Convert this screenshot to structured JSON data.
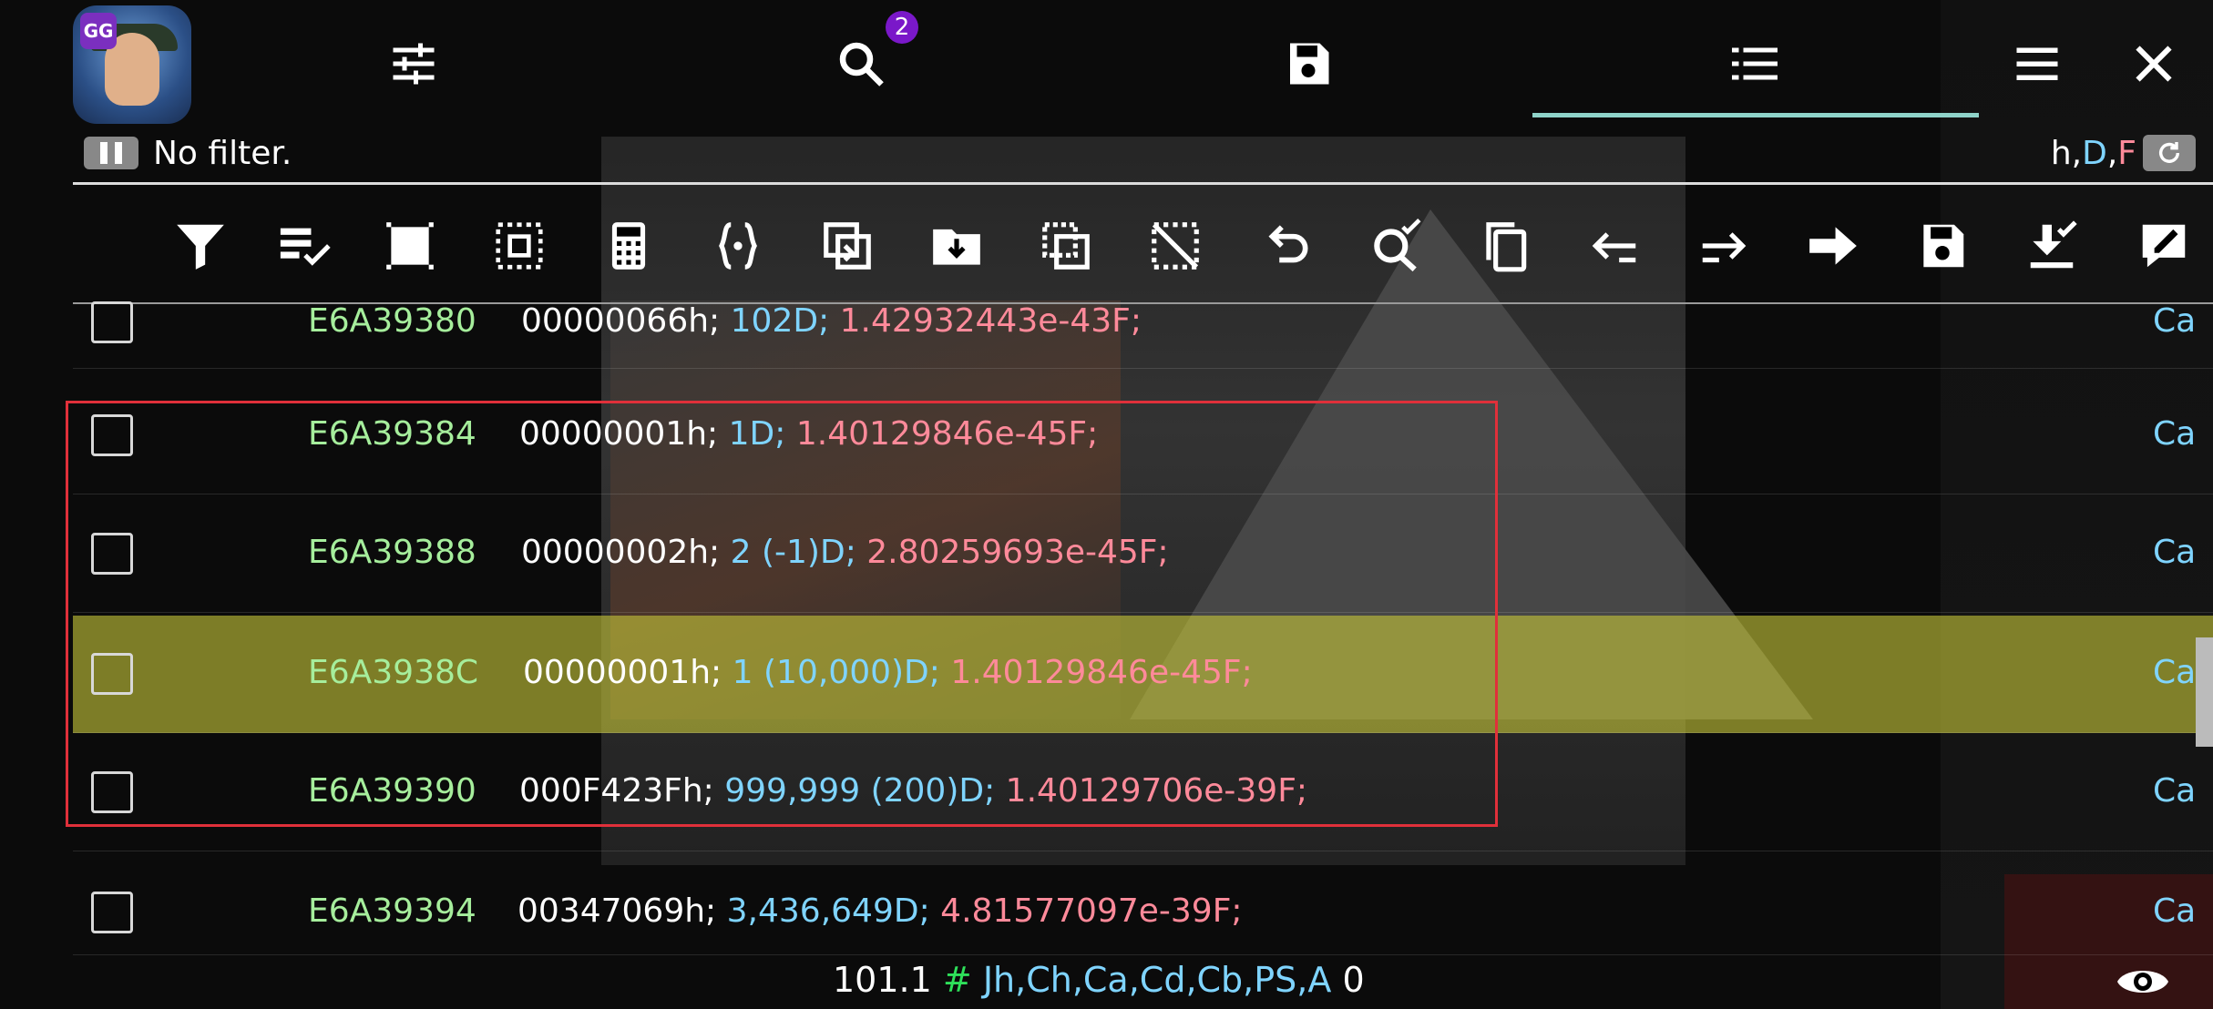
{
  "app": {
    "icon_badge": "GG"
  },
  "toolbar_top": {
    "search_badge": "2"
  },
  "filter": {
    "label": "No filter.",
    "types_h": "h",
    "types_D": "D",
    "types_F": "F",
    "sep1": ",",
    "sep2": ","
  },
  "rows": [
    {
      "address": "E6A39380",
      "hex": "00000066h;",
      "dec": "102D;",
      "float": "1.42932443e-43F;",
      "region": "Ca",
      "selected": false,
      "highlighted": false
    },
    {
      "address": "E6A39384",
      "hex": "00000001h;",
      "dec": "1D;",
      "float": "1.40129846e-45F;",
      "region": "Ca",
      "selected": false,
      "highlighted": false
    },
    {
      "address": "E6A39388",
      "hex": "00000002h;",
      "dec": "2 (-1)D;",
      "float": "2.80259693e-45F;",
      "region": "Ca",
      "selected": false,
      "highlighted": false
    },
    {
      "address": "E6A3938C",
      "hex": "00000001h;",
      "dec": "1 (10,000)D;",
      "float": "1.40129846e-45F;",
      "region": "Ca",
      "selected": false,
      "highlighted": true
    },
    {
      "address": "E6A39390",
      "hex": "000F423Fh;",
      "dec": "999,999 (200)D;",
      "float": "1.40129706e-39F;",
      "region": "Ca",
      "selected": false,
      "highlighted": false
    },
    {
      "address": "E6A39394",
      "hex": "00347069h;",
      "dec": "3,436,649D;",
      "float": "4.81577097e-39F;",
      "region": "Ca",
      "selected": false,
      "highlighted": false
    }
  ],
  "status": {
    "count": "101.1",
    "hash": "#",
    "regions": "Jh,Ch,Ca,Cd,Cb,PS,A",
    "zero": "0"
  },
  "colors": {
    "address": "#a6ee9c",
    "decimal": "#7fd4ff",
    "float": "#ff8a9a",
    "highlight": "#c4c438",
    "selection_box": "#e0303a",
    "tab_underline": "#8fd3c9",
    "badge": "#7a18c9"
  },
  "icons": {
    "top": [
      "settings-sliders-icon",
      "search-icon",
      "save-icon",
      "list-icon",
      "menu-icon",
      "close-icon"
    ],
    "toolbar": [
      "filter-icon",
      "select-edit-icon",
      "select-all-icon",
      "invert-selection-icon",
      "calculator-icon",
      "braces-icon",
      "copy-to-icon",
      "move-to-folder-icon",
      "clone-selection-icon",
      "clear-selection-icon",
      "undo-icon",
      "search-nearby-icon",
      "copy-icon",
      "go-back-icon",
      "go-forward-icon",
      "go-to-icon",
      "save-list-icon",
      "load-list-icon",
      "edit-selected-icon"
    ]
  }
}
